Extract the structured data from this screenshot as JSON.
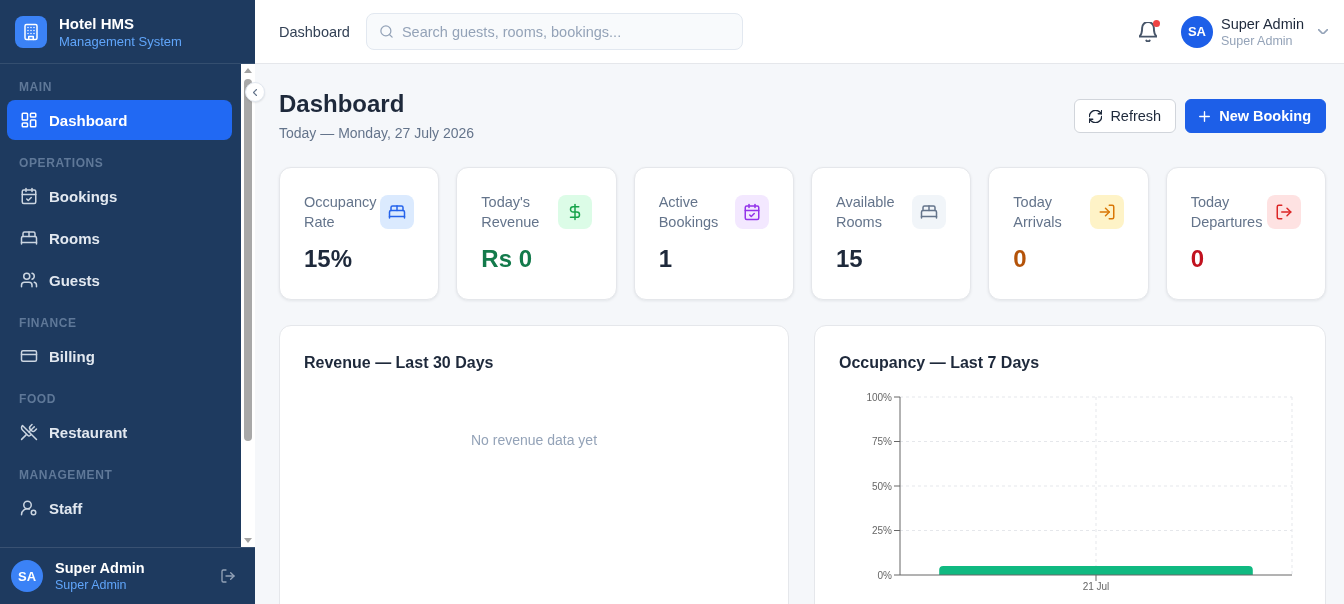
{
  "sidebar": {
    "brand": {
      "name": "Hotel HMS",
      "subtitle": "Management System"
    },
    "sections": [
      {
        "label": "MAIN",
        "items": [
          {
            "label": "Dashboard",
            "selected": true
          }
        ]
      },
      {
        "label": "OPERATIONS",
        "items": [
          {
            "label": "Bookings",
            "selected": false
          },
          {
            "label": "Rooms",
            "selected": false
          },
          {
            "label": "Guests",
            "selected": false
          }
        ]
      },
      {
        "label": "FINANCE",
        "items": [
          {
            "label": "Billing",
            "selected": false
          }
        ]
      },
      {
        "label": "FOOD",
        "items": [
          {
            "label": "Restaurant",
            "selected": false
          }
        ]
      },
      {
        "label": "MANAGEMENT",
        "items": [
          {
            "label": "Staff",
            "selected": false
          }
        ]
      }
    ],
    "user": {
      "initials": "SA",
      "name": "Super Admin",
      "role": "Super Admin"
    }
  },
  "topbar": {
    "breadcrumb": "Dashboard",
    "search": {
      "placeholder": "Search guests, rooms, bookings..."
    },
    "notifications": {
      "unread": true
    },
    "user": {
      "initials": "SA",
      "name": "Super Admin",
      "role": "Super Admin"
    }
  },
  "page": {
    "title": "Dashboard",
    "subtitle": "Today — Monday, 27 July 2026",
    "buttons": [
      {
        "label": "Refresh",
        "kind": "secondary"
      },
      {
        "label": "New Booking",
        "kind": "primary"
      }
    ]
  },
  "stats": [
    {
      "kind": "occupancy",
      "label": "Occupancy Rate",
      "value": "15%"
    },
    {
      "kind": "revenue",
      "label": "Today's Revenue",
      "value": "Rs 0"
    },
    {
      "kind": "bookings",
      "label": "Active Bookings",
      "value": "1"
    },
    {
      "kind": "rooms",
      "label": "Available Rooms",
      "value": "15"
    },
    {
      "kind": "arrivals",
      "label": "Today Arrivals",
      "value": "0"
    },
    {
      "kind": "departures",
      "label": "Today Departures",
      "value": "0"
    }
  ],
  "revenue_panel": {
    "title": "Revenue — Last 30 Days",
    "empty_message": "No revenue data yet"
  },
  "occupancy_panel": {
    "chart_data": {
      "type": "bar",
      "title": "Occupancy — Last 7 Days",
      "categories": [
        "21 Jul"
      ],
      "values": [
        5
      ],
      "ylim": [
        0,
        100
      ],
      "yticks": [
        {
          "value": 0,
          "label": "0%"
        },
        {
          "value": 25,
          "label": "25%"
        },
        {
          "value": 50,
          "label": "50%"
        },
        {
          "value": 75,
          "label": "75%"
        },
        {
          "value": 100,
          "label": "100%"
        }
      ],
      "grid": true
    }
  }
}
